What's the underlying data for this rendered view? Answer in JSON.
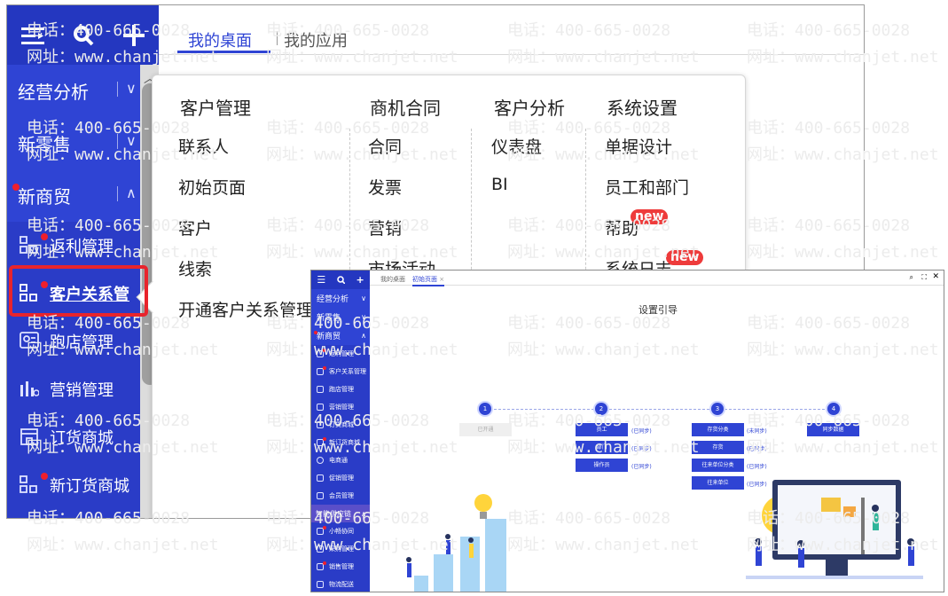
{
  "sidebar": {
    "groups": [
      {
        "label": "经营分析",
        "chevron": "∨"
      },
      {
        "label": "新零售",
        "chevron": "∨"
      },
      {
        "label": "新商贸",
        "chevron": "∧"
      }
    ],
    "items": [
      {
        "label": "返利管理",
        "icon": "grid-icon"
      },
      {
        "label": "客户关系管",
        "icon": "grid-icon"
      },
      {
        "label": "跑店管理",
        "icon": "id-card-icon"
      },
      {
        "label": "营销管理",
        "icon": "chart-icon"
      },
      {
        "label": "订货商城",
        "icon": "store-icon"
      },
      {
        "label": "新订货商城",
        "icon": "grid-icon"
      }
    ]
  },
  "tabs": [
    "我的桌面",
    "我的应用"
  ],
  "menu": {
    "columns": [
      {
        "header": "客户管理",
        "items": [
          "联系人",
          "初始页面",
          "客户",
          "线索",
          "开通客户关系管理"
        ]
      },
      {
        "header": "商机合同",
        "items": [
          "合同",
          "发票",
          "营销",
          "市场活动"
        ]
      },
      {
        "header": "客户分析",
        "items": [
          "仪表盘",
          "BI"
        ]
      },
      {
        "header": "系统设置",
        "items": [
          "单据设计",
          "员工和部门",
          "帮助",
          "系统日志"
        ]
      }
    ],
    "badge": "new"
  },
  "watermark": {
    "phone": "电话：400-665-0028",
    "site": "网址：www.chanjet.net"
  },
  "inset": {
    "tabs": [
      "我的桌面",
      "初始页面"
    ],
    "tab_close": "×",
    "title": "设置引导",
    "sidebar_groups": [
      {
        "label": "经营分析",
        "chevron": "∨"
      },
      {
        "label": "新零售",
        "chevron": "∨"
      },
      {
        "label": "新商贸",
        "chevron": "∧"
      }
    ],
    "sidebar_items": [
      "返利管理",
      "客户关系管理",
      "跑店管理",
      "营销管理",
      "订货商城",
      "新订货商城",
      "电商通",
      "促销管理",
      "会员管理"
    ],
    "section": "智能供应链",
    "section_items": [
      "小畅协同",
      "采购管理",
      "销售管理",
      "物流配送"
    ],
    "steps": [
      "1",
      "2",
      "3",
      "4"
    ],
    "step1": {
      "label": "已开通"
    },
    "step2": [
      {
        "label": "员工",
        "status": "(已同步)"
      },
      {
        "label": "部门",
        "status": "(已同步)"
      },
      {
        "label": "操作员",
        "status": "(已同步)"
      }
    ],
    "step3": [
      {
        "label": "存货分类",
        "status": "(未同步)"
      },
      {
        "label": "存货",
        "status": "(已同步)"
      },
      {
        "label": "往来单位分类",
        "status": "(已同步)"
      },
      {
        "label": "往来单位",
        "status": "(已同步)"
      }
    ],
    "step4": {
      "label": "同步数据"
    }
  }
}
